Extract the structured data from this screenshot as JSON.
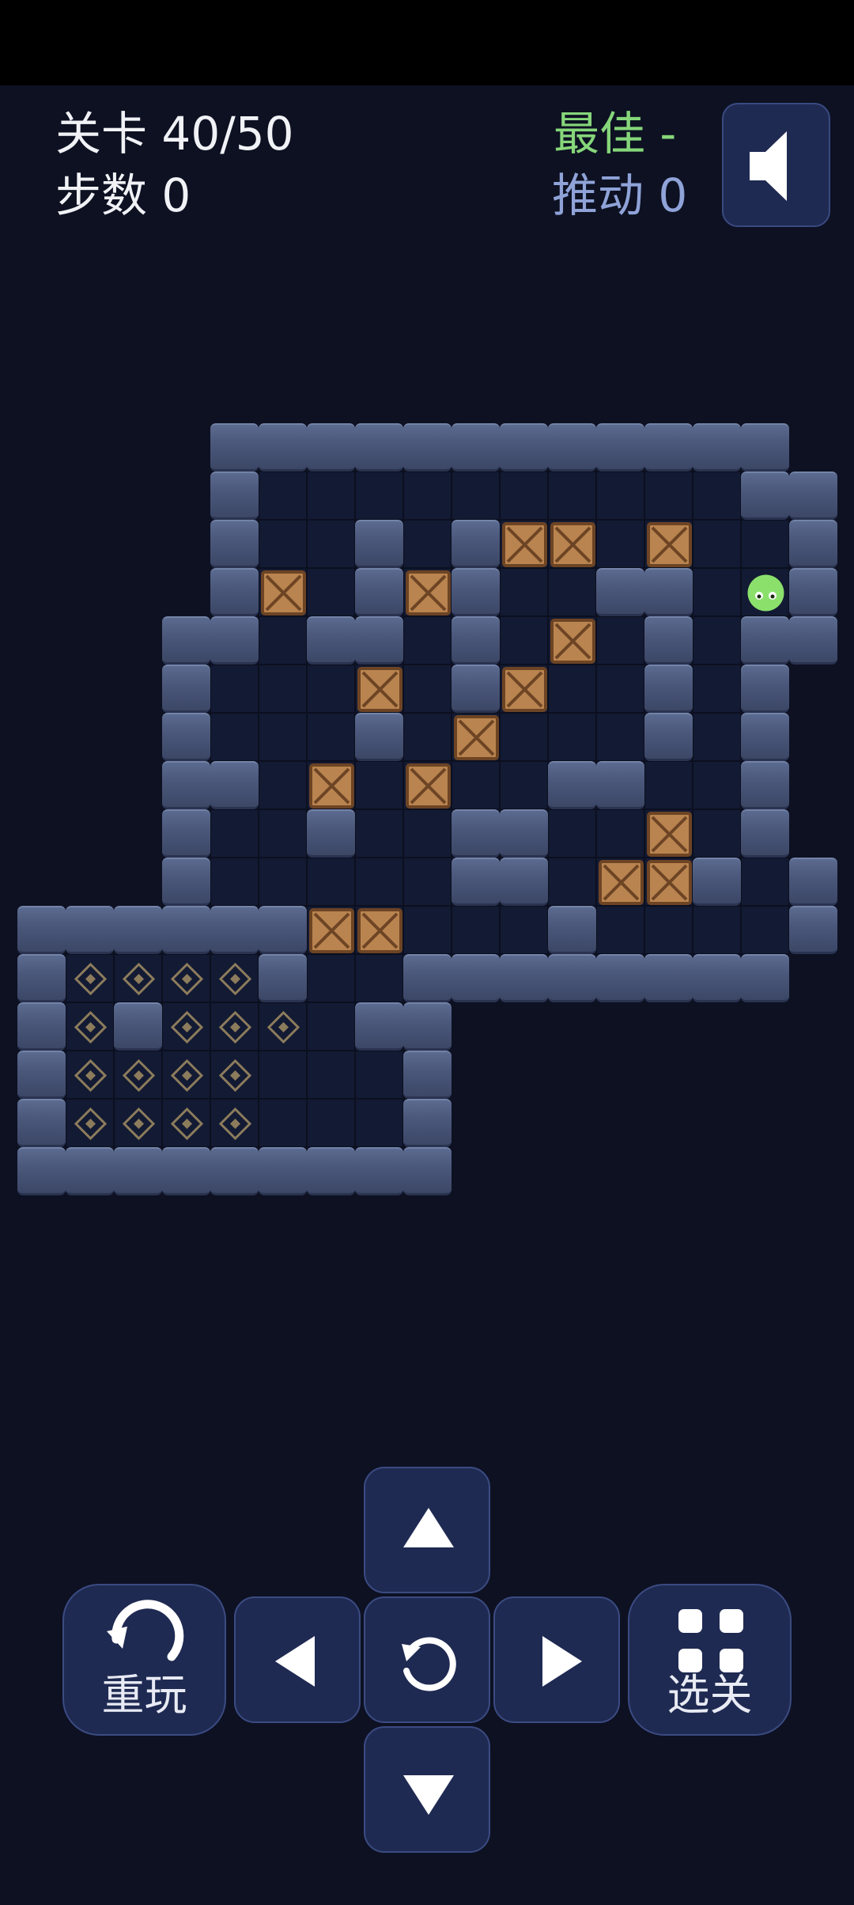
{
  "hud": {
    "level": "关卡 40/50",
    "steps": "步数 0",
    "best": "最佳 -",
    "pushes": "推动 0"
  },
  "controls": {
    "restart_label": "重玩",
    "levels_label": "选关"
  },
  "icons": {
    "sound": "speaker-icon",
    "up": "arrow-up-icon",
    "down": "arrow-down-icon",
    "left": "arrow-left-icon",
    "right": "arrow-right-icon",
    "undo": "undo-icon",
    "restart": "restart-icon",
    "levels": "grid-icon"
  },
  "colors": {
    "background": "#0d1122",
    "best": "#86d67a",
    "pushes": "#8fa3d8",
    "player": "#8be06c",
    "box": "#c08a55"
  },
  "map_legend": {
    "#": "wall",
    "-": "floor",
    "$": "box",
    ".": "goal",
    "@": "player",
    "space": "empty"
  },
  "map": [
    "    ############  ",
    "    #----------## ",
    "    #--#-#$$-$--# ",
    "    #$-#$#--##-@# ",
    "   ##-##-#-$-#-## ",
    "   #---$-#$--#-#  ",
    "   #---#-$---#-#  ",
    "   ##-$-$--##--#  ",
    "   #--#--##--$-#  ",
    "   #-----##-$$#-#  ",
    "######$$---#----# ",
    "#....#--########  ",
    "#.#...-##         ",
    "#....---#         ",
    "#....---#         ",
    "#########         "
  ]
}
